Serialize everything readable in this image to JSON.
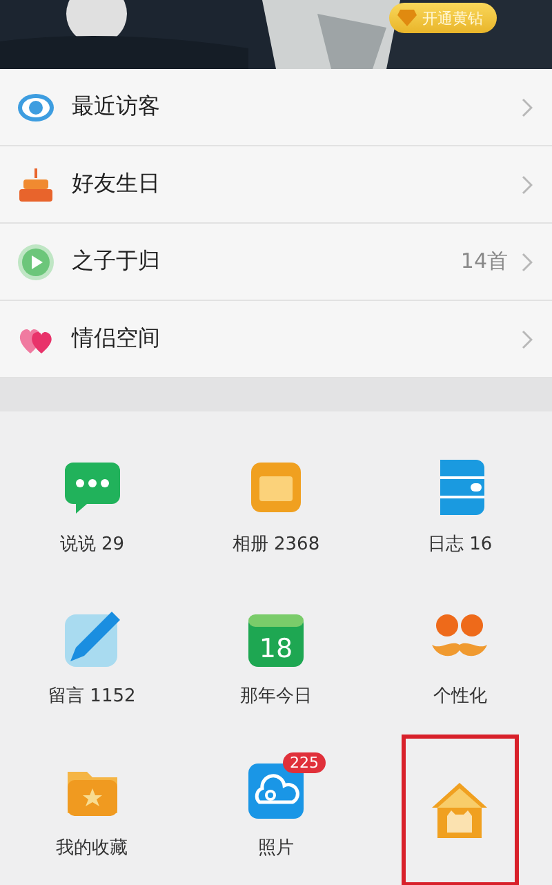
{
  "header": {
    "vip_button": "开通黄钻"
  },
  "menu": [
    {
      "label": "最近访客"
    },
    {
      "label": "好友生日"
    },
    {
      "label": "之子于归",
      "value": "14首"
    },
    {
      "label": "情侣空间"
    }
  ],
  "grid": [
    {
      "label": "说说 29",
      "highlighted": false
    },
    {
      "label": "相册 2368",
      "highlighted": false
    },
    {
      "label": "日志 16",
      "highlighted": false
    },
    {
      "label": "留言 1152",
      "highlighted": false
    },
    {
      "label": "那年今日",
      "day": "18",
      "highlighted": false
    },
    {
      "label": "个性化",
      "highlighted": false
    },
    {
      "label": "我的收藏",
      "highlighted": false
    },
    {
      "label": "照片",
      "badge": "225",
      "highlighted": false
    },
    {
      "highlighted": true
    }
  ]
}
